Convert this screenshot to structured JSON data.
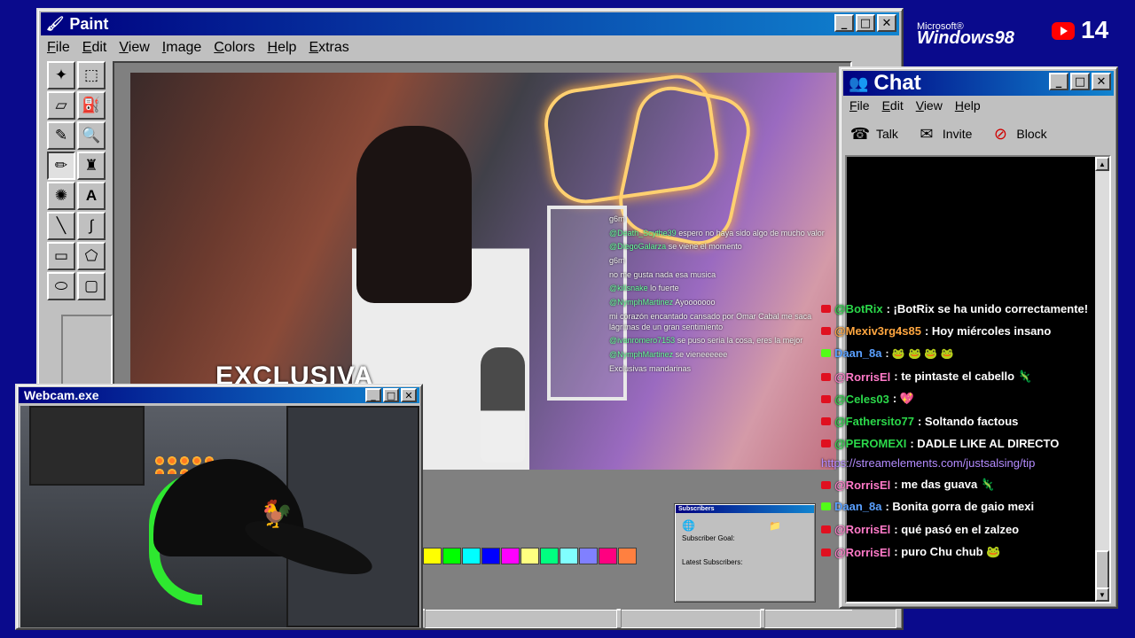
{
  "paint": {
    "title": "Paint",
    "menus": [
      "File",
      "Edit",
      "View",
      "Image",
      "Colors",
      "Help",
      "Extras"
    ],
    "tools": [
      "free-select",
      "rect-select",
      "eraser",
      "fill",
      "picker",
      "magnifier",
      "pencil",
      "brush",
      "airbrush",
      "text",
      "line",
      "curve",
      "rectangle",
      "polygon",
      "ellipse",
      "rounded-rect"
    ],
    "palette": [
      "#ffff00",
      "#00ff00",
      "#00ffff",
      "#0000ff",
      "#ff00ff",
      "#ffff80",
      "#00ff80",
      "#80ffff",
      "#8080ff",
      "#ff0080",
      "#ff8040"
    ]
  },
  "stream": {
    "caption": "EXCLUSIVA",
    "overlay_chat": [
      {
        "user": "",
        "text": "g6m"
      },
      {
        "user": "@Death_Scythe39",
        "text": "espero no haya sido algo de mucho valor"
      },
      {
        "user": "@DiegoGalarza",
        "text": "se viene el momento"
      },
      {
        "user": "",
        "text": "g6m"
      },
      {
        "user": "",
        "text": "no me gusta nada esa musica"
      },
      {
        "user": "@killsnake",
        "text": "lo fuerte"
      },
      {
        "user": "@NymphMartinez",
        "text": "Ayooooooo"
      },
      {
        "user": "",
        "text": "mi corazón encantado cansado por Omar Cabal me saca lágrimas de un gran sentimiento"
      },
      {
        "user": "@ivanromero7153",
        "text": "se puso seria la cosa, eres la mejor"
      },
      {
        "user": "@NymphMartinez",
        "text": "se vieneeeeee"
      },
      {
        "user": "",
        "text": "Exclusivas mandarinas"
      }
    ]
  },
  "subscribers_widget": {
    "title": "Subscribers",
    "goal_label": "Subscriber Goal:",
    "latest_label": "Latest Subscribers:"
  },
  "branding": {
    "microsoft": "Microsoft®",
    "windows": "Windows98",
    "youtube_count": "14"
  },
  "chat": {
    "title": "Chat",
    "menus": [
      "File",
      "Edit",
      "View",
      "Help"
    ],
    "tools": [
      {
        "label": "Talk",
        "icon": "phone-icon"
      },
      {
        "label": "Invite",
        "icon": "invite-icon"
      },
      {
        "label": "Block",
        "icon": "block-icon"
      }
    ],
    "messages": [
      {
        "user": "@BotRix",
        "text": ": ¡BotRix se ha unido correctamente!",
        "color": "green"
      },
      {
        "user": "@Mexiv3rg4s85",
        "text": ": Hoy miércoles insano",
        "color": "orange"
      },
      {
        "user": "Daan_8a",
        "text": ": 🐸 🐸 🐸 🐸",
        "color": "blue"
      },
      {
        "user": "@RorrisEl",
        "text": ": te pintaste el cabello 🦎",
        "color": "pink"
      },
      {
        "user": "@Celes03",
        "text": ": 💖",
        "color": "green"
      },
      {
        "user": "@Fathersito77",
        "text": ": Soltando factous",
        "color": "green"
      },
      {
        "user": "@PEROMEXI",
        "text": ": DADLE LIKE AL DIRECTO",
        "color": "green"
      },
      {
        "user": "",
        "text": "https://streamelements.com/justsalsing/tip",
        "color": "link"
      },
      {
        "user": "@RorrisEl",
        "text": ": me das guava 🦎",
        "color": "pink"
      },
      {
        "user": "Daan_8a",
        "text": ": Bonita gorra de gaio mexi",
        "color": "blue"
      },
      {
        "user": "@RorrisEl",
        "text": ": qué pasó en el zalzeo",
        "color": "pink"
      },
      {
        "user": "@RorrisEl",
        "text": ": puro Chu chub 🐸",
        "color": "pink"
      }
    ]
  },
  "webcam": {
    "title": "Webcam.exe"
  }
}
